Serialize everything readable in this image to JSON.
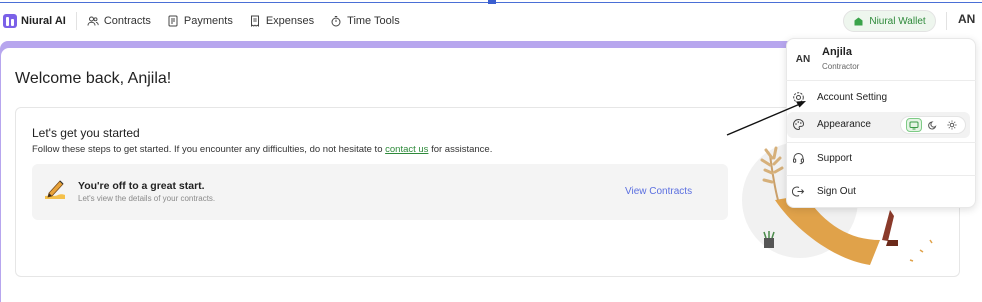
{
  "nav": {
    "brand": "Niural AI",
    "items": [
      {
        "label": "Contracts",
        "icon": "users-icon"
      },
      {
        "label": "Payments",
        "icon": "invoice-icon"
      },
      {
        "label": "Expenses",
        "icon": "receipt-icon"
      },
      {
        "label": "Time Tools",
        "icon": "stopwatch-icon"
      }
    ],
    "wallet_label": "Niural Wallet",
    "avatar_initials": "AN"
  },
  "main": {
    "welcome": "Welcome back, Anjila!",
    "get_started_title": "Let's get you started",
    "get_started_desc_prefix": "Follow these steps to get started. If you encounter any difficulties, do not hesitate to",
    "get_started_link": "contact us",
    "get_started_desc_suffix": "for assistance.",
    "start_title": "You're off to a great start.",
    "start_subtitle": "Let's view the details of your contracts.",
    "view_contracts": "View Contracts"
  },
  "dropdown": {
    "avatar_initials": "AN",
    "name": "Anjila",
    "role": "Contractor",
    "items": [
      {
        "label": "Account Setting",
        "icon": "gear-icon"
      },
      {
        "label": "Appearance",
        "icon": "palette-icon"
      },
      {
        "label": "Support",
        "icon": "headset-icon"
      },
      {
        "label": "Sign Out",
        "icon": "sign-out-icon"
      }
    ],
    "theme_options": [
      "monitor-icon",
      "moon-icon",
      "sun-icon"
    ],
    "theme_selected": "monitor-icon"
  },
  "colors": {
    "accent_purple": "#b7a6ee",
    "brand_green": "#2e8a3a",
    "link_blue": "#5b6fe0"
  }
}
